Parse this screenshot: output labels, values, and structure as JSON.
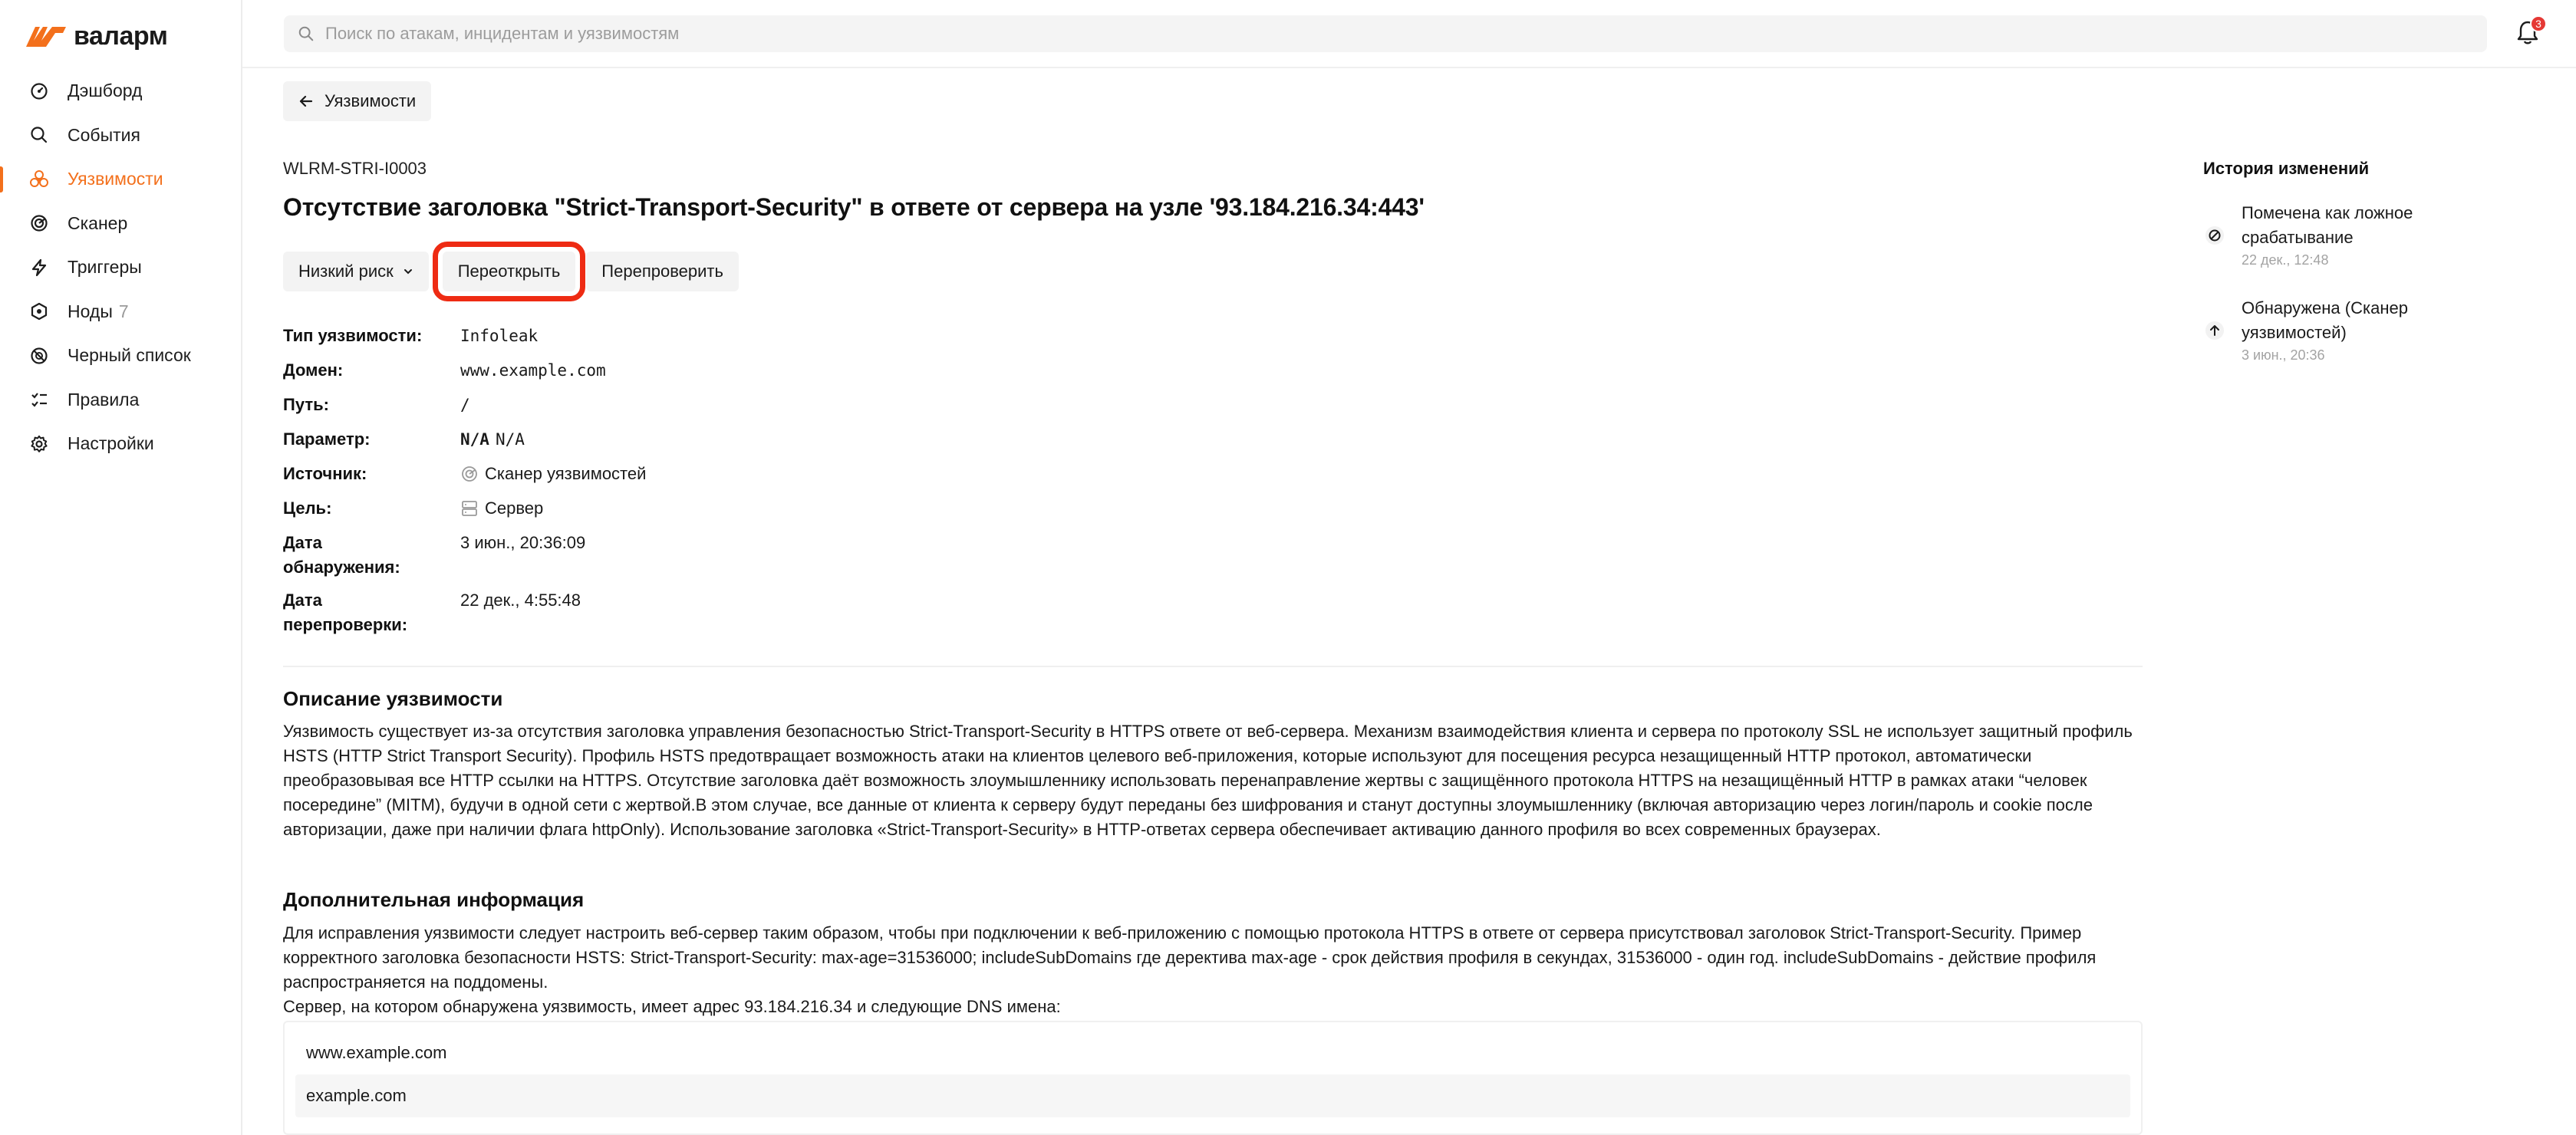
{
  "app": {
    "logo_text": "валарм",
    "brand_color": "#f3701c"
  },
  "sidebar": {
    "items": [
      {
        "label": "Дэшборд",
        "icon": "dashboard-icon"
      },
      {
        "label": "События",
        "icon": "search-icon"
      },
      {
        "label": "Уязвимости",
        "icon": "biohazard-icon",
        "active": true
      },
      {
        "label": "Сканер",
        "icon": "scanner-icon"
      },
      {
        "label": "Триггеры",
        "icon": "lightning-icon"
      },
      {
        "label": "Ноды",
        "icon": "nodes-icon",
        "count": "7"
      },
      {
        "label": "Черный список",
        "icon": "blacklist-icon"
      },
      {
        "label": "Правила",
        "icon": "rules-icon"
      },
      {
        "label": "Настройки",
        "icon": "gear-icon"
      }
    ]
  },
  "header": {
    "search_placeholder": "Поиск по атакам, инцидентам и уязвимостям",
    "notification_count": "3"
  },
  "main": {
    "back_label": "Уязвимости",
    "vuln_id": "WLRM-STRI-I0003",
    "title": "Отсутствие заголовка \"Strict-Transport-Security\" в ответе от сервера на узле '93.184.216.34:443'",
    "actions": {
      "risk_label": "Низкий риск",
      "reopen_label": "Переоткрыть",
      "recheck_label": "Перепроверить"
    },
    "details": {
      "type_label": "Тип уязвимости:",
      "type_value": "Infoleak",
      "domain_label": "Домен:",
      "domain_value": "www.example.com",
      "path_label": "Путь:",
      "path_value": "/",
      "param_label": "Параметр:",
      "param_value_bold": "N/A",
      "param_value": "N/A",
      "source_label": "Источник:",
      "source_value": "Сканер уязвимостей",
      "target_label": "Цель:",
      "target_value": "Сервер",
      "detected_label_1": "Дата",
      "detected_label_2": "обнаружения:",
      "detected_value": "3 июн., 20:36:09",
      "rechecked_label_1": "Дата",
      "rechecked_label_2": "перепроверки:",
      "rechecked_value": "22 дек., 4:55:48"
    },
    "description": {
      "title": "Описание уязвимости",
      "text": "Уязвимость существует из-за отсутствия заголовка управления безопасностью Strict-Transport-Security в HTTPS ответе от веб-сервера. Механизм взаимодействия клиента и сервера по протоколу SSL не использует защитный профиль HSTS (HTTP Strict Transport Security). Профиль HSTS предотвращает возможность атаки на клиентов целевого веб-приложения, которые используют для посещения ресурса незащищенный HTTP протокол, автоматически преобразовывая все HTTP ссылки на HTTPS. Отсутствие заголовка даёт возможность злоумышленнику использовать перенаправление жертвы с защищённого протокола HTTPS на незащищённый HTTP в рамках атаки “человек посередине” (MITM), будучи в одной сети с жертвой.В этом случае, все данные от клиента к серверу будут переданы без шифрования и станут доступны злоумышленнику (включая авторизацию через логин/пароль и cookie после авторизации, даже при наличии флага httpOnly). Использование заголовка «Strict-Transport-Security» в HTTP-ответах сервера обеспечивает активацию данного профиля во всех современных браузерах."
    },
    "additional": {
      "title": "Дополнительная информация",
      "text": "Для исправления уязвимости следует настроить веб-сервер таким образом, чтобы при подключении к веб-приложению с помощью протокола HTTPS в ответе от сервера присутствовал заголовок Strict-Transport-Security. Пример корректного заголовка безопасности HSTS: Strict-Transport-Security: max-age=31536000; includeSubDomains где деректива max-age - срок действия профиля в секундах, 31536000 - один год. includeSubDomains - действие профиля распространяется на поддомены.",
      "server_text": "Сервер, на котором обнаружена уязвимость, имеет адрес 93.184.216.34 и следующие DNS имена:",
      "dns": [
        "www.example.com",
        "example.com"
      ]
    }
  },
  "history": {
    "title": "История изменений",
    "items": [
      {
        "text": "Помечена как ложное срабатывание",
        "time": "22 дек., 12:48",
        "icon": "false-positive-icon"
      },
      {
        "text": "Обнаружена (Сканер уязвимостей)",
        "time": "3 июн., 20:36",
        "icon": "arrow-up-icon"
      }
    ]
  }
}
